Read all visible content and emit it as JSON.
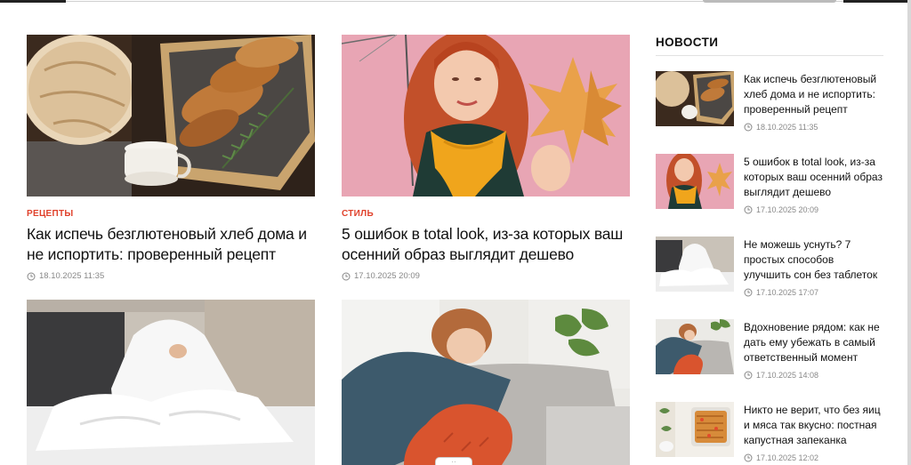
{
  "colors": {
    "accent": "#e0422c",
    "meta": "#888888",
    "text": "#111111"
  },
  "cards": [
    {
      "category": "Рецепты",
      "title": "Как испечь безглютеновый хлеб дома и не испортить: проверенный рецепт",
      "date": "18.10.2025 11:35",
      "image": "bread-basket-milk"
    },
    {
      "category": "Стиль",
      "title": "5 ошибок в total look, из-за которых ваш осенний образ выглядит дешево",
      "date": "17.10.2025 20:09",
      "image": "woman-autumn-leaves"
    },
    {
      "image": "woman-bed-blanket"
    },
    {
      "image": "woman-sofa-tired"
    }
  ],
  "sidebar": {
    "heading": "Новости",
    "items": [
      {
        "title": "Как испечь безглютеновый хлеб дома и не испортить: проверенный рецепт",
        "date": "18.10.2025 11:35"
      },
      {
        "title": "5 ошибок в total look, из-за которых ваш осенний образ выглядит дешево",
        "date": "17.10.2025 20:09"
      },
      {
        "title": "Не можешь уснуть? 7 простых способов улучшить сон без таблеток",
        "date": "17.10.2025 17:07"
      },
      {
        "title": "Вдохновение рядом: как не дать ему убежать в самый ответственный момент",
        "date": "17.10.2025 14:08"
      },
      {
        "title": "Никто не верит, что без яиц и мяса так вкусно: постная капустная запеканка",
        "date": "17.10.2025 12:02"
      }
    ]
  },
  "icons": {
    "clock": "clock-icon"
  }
}
